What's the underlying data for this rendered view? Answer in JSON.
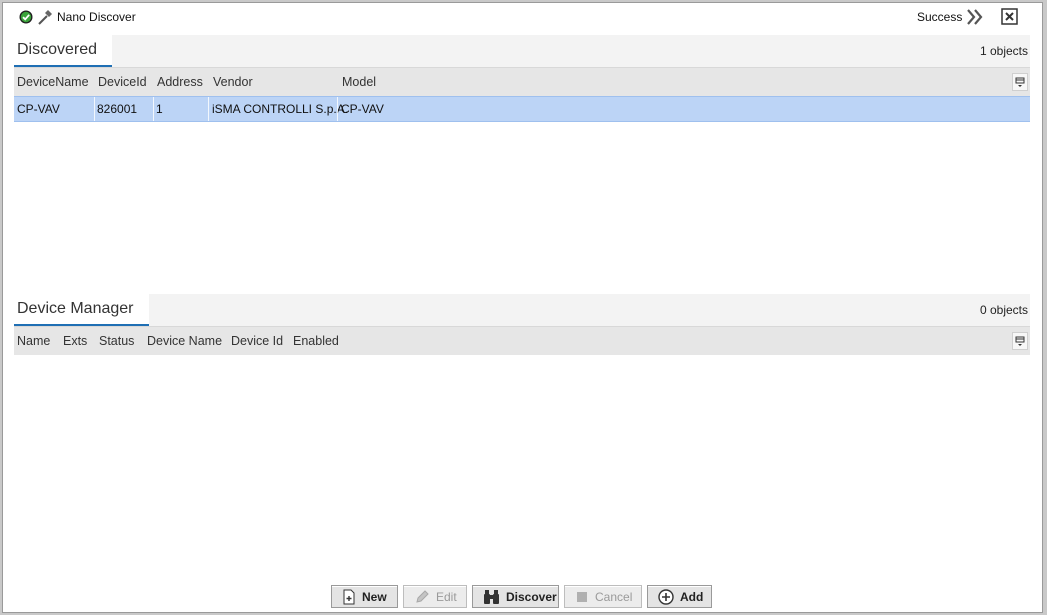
{
  "title_bar": {
    "job_title": "Nano Discover",
    "job_state": "Success",
    "icons": [
      "check-circle-icon",
      "hammer-icon",
      "double-chevron-right-icon",
      "close-box-icon"
    ]
  },
  "discovered": {
    "tab_label": "Discovered",
    "count": "1 objects",
    "columns": [
      "DeviceName",
      "DeviceId",
      "Address",
      "Vendor",
      "Model"
    ],
    "rows": [
      {
        "device_name": "CP-VAV",
        "device_id": "826001",
        "address": "1",
        "vendor": "iSMA CONTROLLI S.p.A.",
        "model": "CP-VAV",
        "selected": true
      }
    ]
  },
  "device_manager": {
    "tab_label": "Device Manager",
    "count": "0 objects",
    "columns": [
      "Name",
      "Exts",
      "Status",
      "Device Name",
      "Device Id",
      "Enabled"
    ],
    "rows": []
  },
  "toolbar": {
    "new_label": "New",
    "edit_label": "Edit",
    "discover_label": "Discover",
    "cancel_label": "Cancel",
    "add_label": "Add"
  },
  "colors": {
    "selection": "#bcd4f6",
    "tab_underline": "#1f6fb4",
    "header_bg": "#e6e6e6",
    "status_ok": "#2e8b2e"
  }
}
